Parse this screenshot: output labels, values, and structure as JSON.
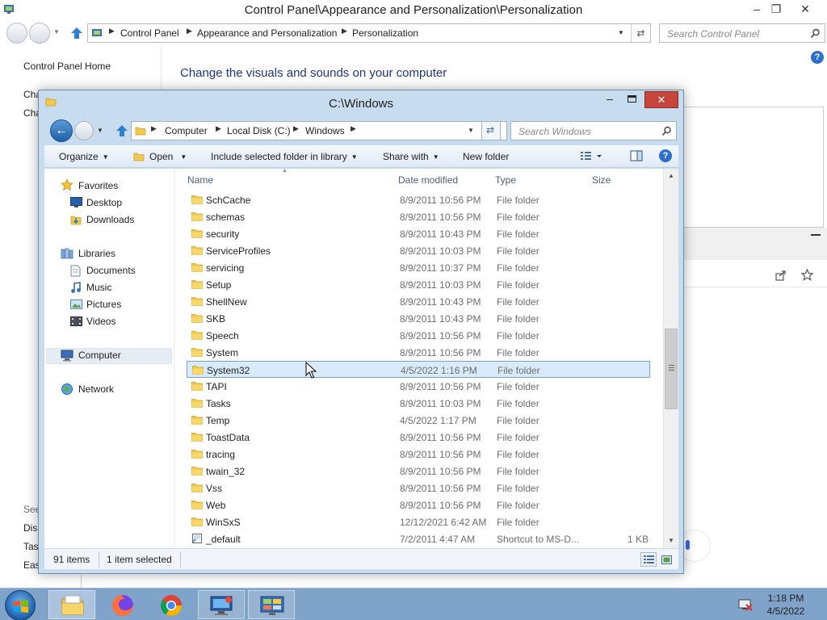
{
  "control_panel": {
    "title": "Control Panel\\Appearance and Personalization\\Personalization",
    "breadcrumbs": [
      "Control Panel",
      "Appearance and Personalization",
      "Personalization"
    ],
    "search_placeholder": "Search Control Panel",
    "left_home": "Control Panel Home",
    "left_links_top": [
      "Cha",
      "Cha"
    ],
    "left_links_bottom": [
      "See",
      "Disp",
      "Tas",
      "Eas"
    ],
    "heading": "Change the visuals and sounds on your computer",
    "help_glyph": "?"
  },
  "explorer": {
    "title": "C:\\Windows",
    "breadcrumbs": [
      "Computer",
      "Local Disk (C:)",
      "Windows"
    ],
    "search_placeholder": "Search Windows",
    "toolbar": {
      "organize": "Organize",
      "open": "Open",
      "include": "Include selected folder in library",
      "share": "Share with",
      "new_folder": "New folder"
    },
    "nav": {
      "favorites": "Favorites",
      "desktop": "Desktop",
      "downloads": "Downloads",
      "libraries": "Libraries",
      "documents": "Documents",
      "music": "Music",
      "pictures": "Pictures",
      "videos": "Videos",
      "computer": "Computer",
      "network": "Network"
    },
    "columns": {
      "name": "Name",
      "date": "Date modified",
      "type": "Type",
      "size": "Size"
    },
    "files": [
      {
        "name": "SchCache",
        "date": "8/9/2011 10:56 PM",
        "type": "File folder",
        "size": ""
      },
      {
        "name": "schemas",
        "date": "8/9/2011 10:56 PM",
        "type": "File folder",
        "size": ""
      },
      {
        "name": "security",
        "date": "8/9/2011 10:43 PM",
        "type": "File folder",
        "size": ""
      },
      {
        "name": "ServiceProfiles",
        "date": "8/9/2011 10:03 PM",
        "type": "File folder",
        "size": ""
      },
      {
        "name": "servicing",
        "date": "8/9/2011 10:37 PM",
        "type": "File folder",
        "size": ""
      },
      {
        "name": "Setup",
        "date": "8/9/2011 10:03 PM",
        "type": "File folder",
        "size": ""
      },
      {
        "name": "ShellNew",
        "date": "8/9/2011 10:43 PM",
        "type": "File folder",
        "size": ""
      },
      {
        "name": "SKB",
        "date": "8/9/2011 10:43 PM",
        "type": "File folder",
        "size": ""
      },
      {
        "name": "Speech",
        "date": "8/9/2011 10:56 PM",
        "type": "File folder",
        "size": ""
      },
      {
        "name": "System",
        "date": "8/9/2011 10:56 PM",
        "type": "File folder",
        "size": ""
      },
      {
        "name": "System32",
        "date": "4/5/2022 1:16 PM",
        "type": "File folder",
        "size": "",
        "selected": true
      },
      {
        "name": "TAPI",
        "date": "8/9/2011 10:56 PM",
        "type": "File folder",
        "size": ""
      },
      {
        "name": "Tasks",
        "date": "8/9/2011 10:03 PM",
        "type": "File folder",
        "size": ""
      },
      {
        "name": "Temp",
        "date": "4/5/2022 1:17 PM",
        "type": "File folder",
        "size": ""
      },
      {
        "name": "ToastData",
        "date": "8/9/2011 10:56 PM",
        "type": "File folder",
        "size": ""
      },
      {
        "name": "tracing",
        "date": "8/9/2011 10:56 PM",
        "type": "File folder",
        "size": ""
      },
      {
        "name": "twain_32",
        "date": "8/9/2011 10:56 PM",
        "type": "File folder",
        "size": ""
      },
      {
        "name": "Vss",
        "date": "8/9/2011 10:56 PM",
        "type": "File folder",
        "size": ""
      },
      {
        "name": "Web",
        "date": "8/9/2011 10:56 PM",
        "type": "File folder",
        "size": ""
      },
      {
        "name": "WinSxS",
        "date": "12/12/2021 6:42 AM",
        "type": "File folder",
        "size": ""
      },
      {
        "name": "_default",
        "date": "7/2/2011 4:47 AM",
        "type": "Shortcut to MS-D...",
        "size": "1 KB",
        "shortcut": true
      }
    ],
    "status": {
      "count": "91 items",
      "selection": "1 item selected"
    }
  },
  "taskbar": {
    "time": "1:18 PM",
    "date": "4/5/2022",
    "apps": [
      "file-explorer",
      "firefox",
      "chrome",
      "remote-desktop",
      "control-panel"
    ]
  },
  "colors": {
    "accent": "#1e3287",
    "selection": "#d9ebfb",
    "close_button": "#c7463b",
    "taskbar": "#7fa3c9"
  }
}
